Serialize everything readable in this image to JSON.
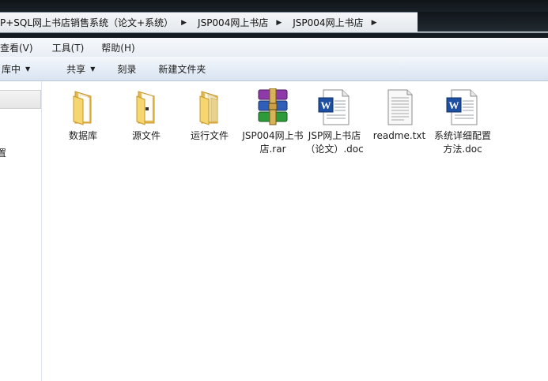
{
  "address_bar": {
    "crumbs": [
      "P+SQL网上书店销售系统（论文+系统）",
      "JSP004网上书店",
      "JSP004网上书店"
    ]
  },
  "menu": {
    "items": [
      "查看(V)",
      "工具(T)",
      "帮助(H)"
    ]
  },
  "commands": {
    "include_in_library": "库中",
    "share": "共享",
    "burn": "刻录",
    "new_folder": "新建文件夹"
  },
  "nav_pane": {
    "partial_label": "置"
  },
  "files": [
    {
      "name": "数据库",
      "type": "folder",
      "icon": "folder-icon"
    },
    {
      "name": "源文件",
      "type": "folder",
      "icon": "folder-icon"
    },
    {
      "name": "运行文件",
      "type": "folder",
      "icon": "folder-icon"
    },
    {
      "name": "JSP004网上书店.rar",
      "type": "rar",
      "icon": "winrar-archive-icon"
    },
    {
      "name": "JSP网上书店（论文）.doc",
      "type": "doc",
      "icon": "word-document-icon"
    },
    {
      "name": "readme.txt",
      "type": "txt",
      "icon": "text-file-icon"
    },
    {
      "name": "系统详细配置方法.doc",
      "type": "doc",
      "icon": "word-document-icon"
    }
  ],
  "colors": {
    "folder": "#f2cf6a",
    "word_blue": "#1d4fa3",
    "commandbar": "#dfe8f3"
  }
}
